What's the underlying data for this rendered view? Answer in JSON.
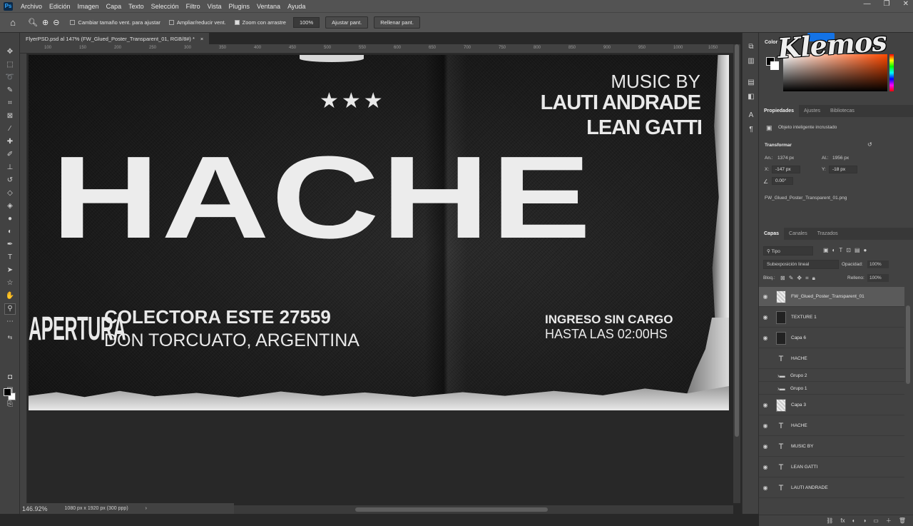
{
  "menu": {
    "logo": "Ps",
    "items": [
      "Archivo",
      "Edición",
      "Imagen",
      "Capa",
      "Texto",
      "Selección",
      "Filtro",
      "Vista",
      "Plugins",
      "Ventana",
      "Ayuda"
    ],
    "window_controls": [
      "—",
      "❐",
      "✕"
    ]
  },
  "options": {
    "resize_windows": "Cambiar tamaño vent. para ajustar",
    "zoom_all": "Ampliar/reducir vent.",
    "scrubby_zoom": "Zoom con arrastre",
    "zoom_value": "100%",
    "fit_screen": "Ajustar pant.",
    "fill_screen": "Rellenar pant."
  },
  "document": {
    "tab_title": "FlyerPSD.psd al 147% (FW_Glued_Poster_Transparent_01, RGB/8#) *",
    "tab_close": "×"
  },
  "ruler_ticks": [
    "100",
    "150",
    "200",
    "250",
    "300",
    "350",
    "400",
    "450",
    "500",
    "550",
    "600",
    "650",
    "700",
    "750",
    "800",
    "850",
    "900",
    "950",
    "1000",
    "1050"
  ],
  "poster": {
    "stars": "★★★",
    "music_by": "MUSIC BY",
    "artist1": "LAUTI ANDRADE",
    "artist2": "LEAN GATTI",
    "title": "HACHE",
    "apertura": "APERTURA",
    "address1": "COLECTORA ESTE 27559",
    "address2": "DON TORCUATO, ARGENTINA",
    "entry1": "INGRESO SIN CARGO",
    "entry2": "HASTA LAS 02:00HS"
  },
  "status": {
    "zoom": "146.92%",
    "dimensions": "1080 px x 1920 px (300 ppp)",
    "arrow": "›"
  },
  "color_panel": {
    "label": "Color",
    "watermark": "Klemos"
  },
  "properties": {
    "tabs": [
      "Propiedades",
      "Ajustes",
      "Bibliotecas"
    ],
    "object_type": "Objeto inteligente incrustado",
    "transform_label": "Transformar",
    "w_label": "An.:",
    "w_value": "1374 px",
    "h_label": "Al.:",
    "h_value": "1956 px",
    "x_label": "X:",
    "x_value": "-147 px",
    "y_label": "Y:",
    "y_value": "-18 px",
    "angle_value": "0.00°",
    "filename": "FW_Glued_Poster_Transparent_01.png"
  },
  "layers_panel": {
    "tabs": [
      "Capas",
      "Canales",
      "Trazados"
    ],
    "filter_label": "Tipo",
    "blend_mode": "Subexposición lineal",
    "opacity_label": "Opacidad:",
    "opacity_value": "100%",
    "lock_label": "Bloq.:",
    "fill_label": "Relleno:",
    "fill_value": "100%",
    "layers": [
      {
        "name": "FW_Glued_Poster_Transparent_01",
        "kind": "image",
        "visible": true,
        "selected": true
      },
      {
        "name": "TEXTURE 1",
        "kind": "image",
        "visible": true
      },
      {
        "name": "Capa 6",
        "kind": "image",
        "visible": true
      },
      {
        "name": "HACHE",
        "kind": "text",
        "visible": false
      },
      {
        "name": "Grupo 2",
        "kind": "group",
        "visible": false
      },
      {
        "name": "Grupo 1",
        "kind": "group",
        "visible": false
      },
      {
        "name": "Capa 3",
        "kind": "image-light",
        "visible": true
      },
      {
        "name": "HACHE",
        "kind": "text",
        "visible": true
      },
      {
        "name": "MUSIC BY",
        "kind": "text",
        "visible": true
      },
      {
        "name": "LEAN GATTI",
        "kind": "text",
        "visible": true
      },
      {
        "name": "LAUTI ANDRADE",
        "kind": "text",
        "visible": true
      }
    ],
    "bottom_icons": [
      "⛓",
      "fx",
      "◐",
      "◑",
      "▭",
      "＋",
      "🗑"
    ]
  }
}
